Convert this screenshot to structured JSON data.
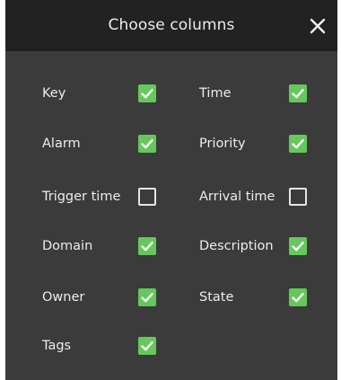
{
  "dialog": {
    "title": "Choose columns",
    "close_icon": "close-icon"
  },
  "colors": {
    "header_bg": "#222222",
    "body_bg": "#3b3b3b",
    "text": "#ececec",
    "checked": "#64c85a"
  },
  "rows": [
    {
      "left": {
        "label": "Key",
        "checked": true
      },
      "right": {
        "label": "Time",
        "checked": true
      }
    },
    {
      "left": {
        "label": "Alarm",
        "checked": true
      },
      "right": {
        "label": "Priority",
        "checked": true
      }
    },
    {
      "left": {
        "label": "Trigger time",
        "checked": false
      },
      "right": {
        "label": "Arrival time",
        "checked": false
      }
    },
    {
      "left": {
        "label": "Domain",
        "checked": true
      },
      "right": {
        "label": "Description",
        "checked": true
      }
    },
    {
      "left": {
        "label": "Owner",
        "checked": true
      },
      "right": {
        "label": "State",
        "checked": true
      }
    },
    {
      "left": {
        "label": "Tags",
        "checked": true
      }
    }
  ]
}
